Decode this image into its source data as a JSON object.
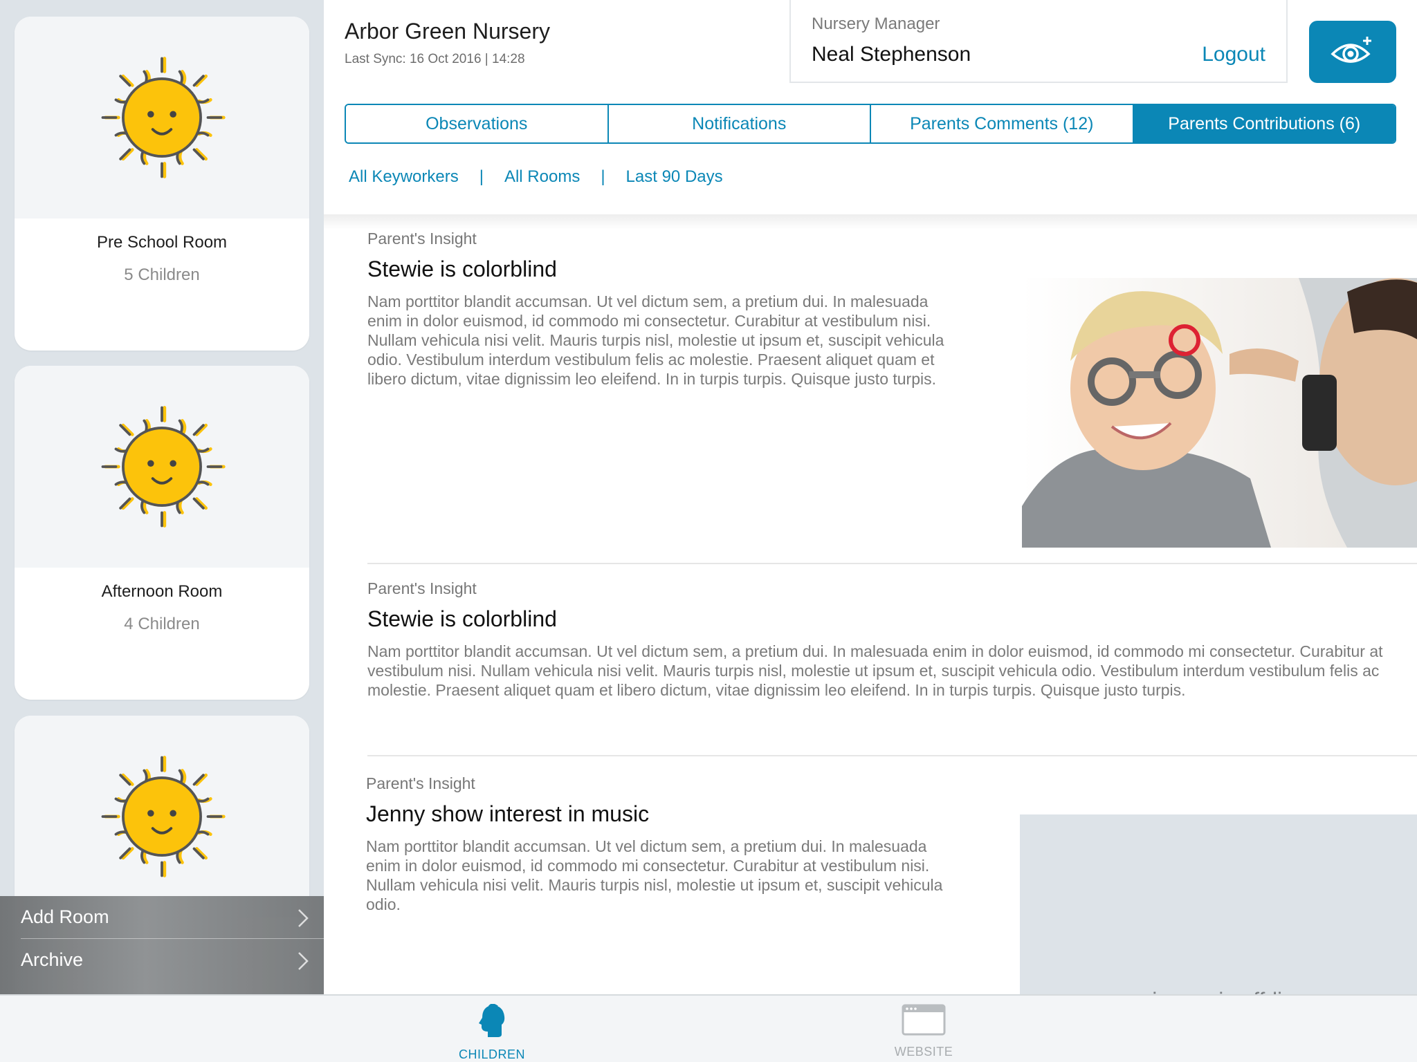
{
  "sidebar": {
    "rooms": [
      {
        "name": "Pre School Room",
        "count": "5 Children"
      },
      {
        "name": "Afternoon Room",
        "count": "4 Children"
      },
      {
        "name": "",
        "count": ""
      }
    ],
    "menu": [
      {
        "label": "Add Room",
        "icon": "chevron-right-icon"
      },
      {
        "label": "Archive",
        "icon": "chevron-right-icon"
      }
    ]
  },
  "header": {
    "nursery_name": "Arbor Green Nursery",
    "last_sync": "Last Sync: 16 Oct 2016 | 14:28",
    "manager_role": "Nursery Manager",
    "manager_name": "Neal Stephenson",
    "logout_label": "Logout",
    "action_icon": "eye-plus-icon"
  },
  "tabs": [
    {
      "label": "Observations",
      "active": false
    },
    {
      "label": "Notifications",
      "active": false
    },
    {
      "label": "Parents Comments (12)",
      "active": false
    },
    {
      "label": "Parents Contributions (6)",
      "active": true
    }
  ],
  "filters": {
    "keyworkers": "All Keyworkers",
    "rooms": "All Rooms",
    "period": "Last 90 Days",
    "separator": "|"
  },
  "posts": [
    {
      "kind": "Parent's Insight",
      "title": "Stewie is colorblind",
      "body": "Nam porttitor blandit accumsan. Ut vel dictum sem, a pretium dui. In malesuada enim in dolor euismod, id commodo mi consectetur. Curabitur at vestibulum nisi. Nullam vehicula nisi velit. Mauris turpis nisl, molestie ut ipsum et, suscipit vehicula odio. Vestibulum interdum vestibulum felis ac molestie. Praesent aliquet quam et libero dictum, vitae dignissim leo eleifend. In in turpis turpis. Quisque justo turpis."
    },
    {
      "kind": "Parent's Insight",
      "title": "Stewie is colorblind",
      "body": "Nam porttitor blandit accumsan. Ut vel dictum sem, a pretium dui. In malesuada enim in dolor euismod, id commodo mi consectetur. Curabitur at vestibulum nisi. Nullam vehicula nisi velit. Mauris turpis nisl, molestie ut ipsum et, suscipit vehicula odio. Vestibulum interdum vestibulum felis ac molestie. Praesent aliquet quam et libero dictum, vitae dignissim leo eleifend. In in turpis turpis. Quisque justo turpis."
    },
    {
      "kind": "Parent's Insight",
      "title": "Jenny show interest in music",
      "body": "Nam porttitor blandit accumsan. Ut vel dictum sem, a pretium dui. In malesuada enim in dolor euismod, id commodo mi consectetur. Curabitur at vestibulum nisi. Nullam vehicula nisi velit. Mauris turpis nisl, molestie ut ipsum et, suscipit vehicula odio.",
      "offline_text": "image is off-line"
    }
  ],
  "tabbar": [
    {
      "label": "CHILDREN",
      "icon": "child-head-icon",
      "active": true
    },
    {
      "label": "WEBSITE",
      "icon": "browser-window-icon",
      "active": false
    }
  ],
  "colors": {
    "accent": "#0b87b6",
    "sidebar_bg": "#dde3e8",
    "sun_yellow": "#fcc30b"
  }
}
